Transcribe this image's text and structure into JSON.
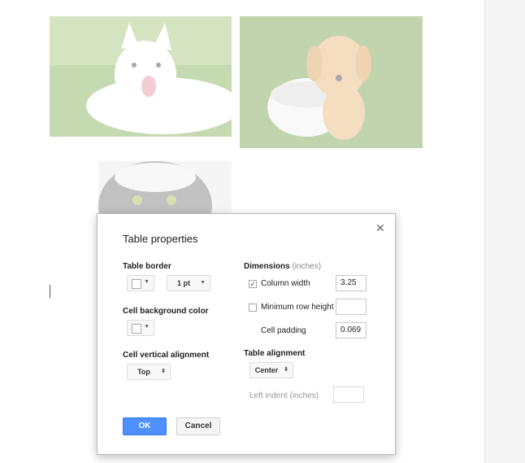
{
  "dialog": {
    "title": "Table properties",
    "table_border": {
      "label": "Table border",
      "color_swatch": "#ffffff",
      "width_value": "1 pt"
    },
    "cell_background": {
      "label": "Cell background color",
      "color_swatch": "#ffffff"
    },
    "vertical_alignment": {
      "label": "Cell vertical alignment",
      "value": "Top"
    },
    "dimensions": {
      "label": "Dimensions",
      "unit": "(inches)",
      "column_width": {
        "label": "Column width",
        "checked": true,
        "value": "3.25"
      },
      "min_row_height": {
        "label": "Minimum row height",
        "checked": false,
        "value": ""
      },
      "cell_padding": {
        "label": "Cell padding",
        "value": "0.069"
      }
    },
    "table_alignment": {
      "label": "Table alignment",
      "value": "Center",
      "left_indent_label": "Left indent",
      "left_indent_unit": "(inches)",
      "left_indent_value": ""
    },
    "ok_label": "OK",
    "cancel_label": "Cancel",
    "close_icon": "close-icon"
  },
  "colors": {
    "ok_button": "#4d90fe",
    "gutter": "#f5f5f5"
  }
}
